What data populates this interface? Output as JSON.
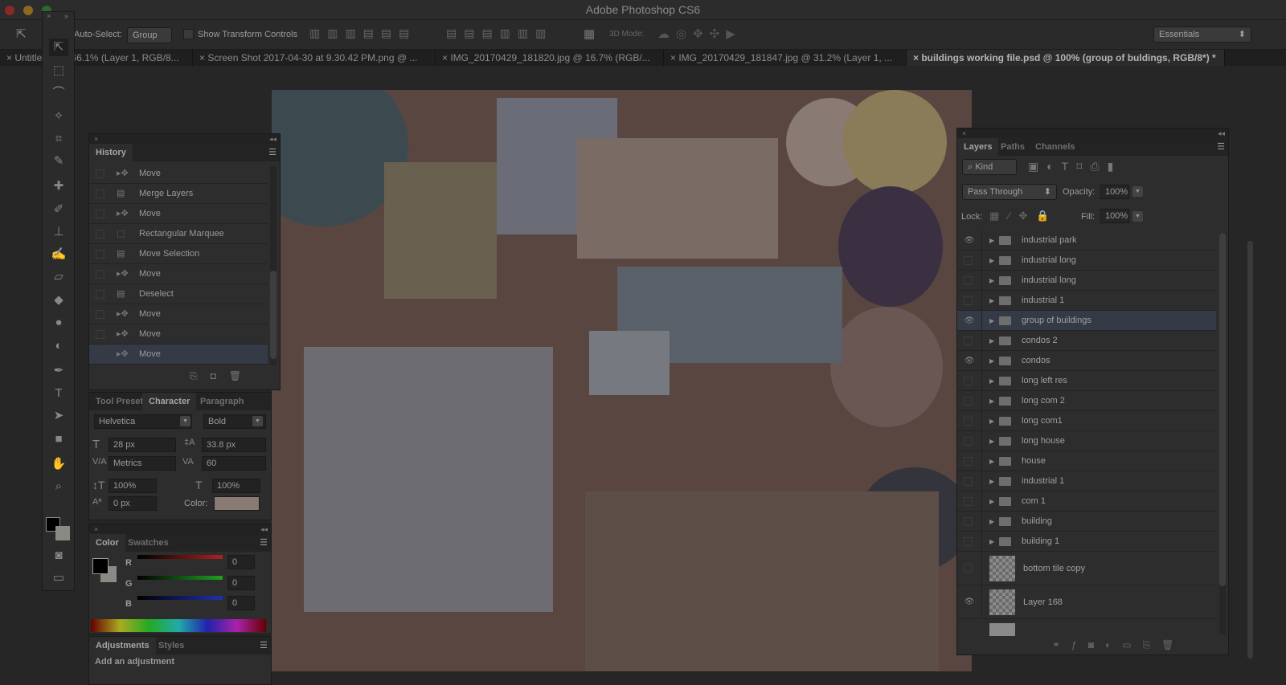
{
  "app": {
    "title": "Adobe Photoshop CS6"
  },
  "options": {
    "auto_select_label": "Auto-Select:",
    "auto_select_value": "Group",
    "show_transform": "Show Transform Controls",
    "mode_3d": "3D Mode:",
    "workspace": "Essentials"
  },
  "tabs": [
    {
      "label": "Untitled-1 @ 66.1% (Layer 1, RGB/8..."
    },
    {
      "label": "Screen Shot 2017-04-30 at 9.30.42 PM.png @ ..."
    },
    {
      "label": "IMG_20170429_181820.jpg @ 16.7% (RGB/..."
    },
    {
      "label": "IMG_20170429_181847.jpg @ 31.2% (Layer 1, ..."
    },
    {
      "label": "buildings working file.psd @ 100% (group of buldings, RGB/8*) *"
    }
  ],
  "history": {
    "title": "History",
    "items": [
      {
        "label": "Move",
        "icon": "move"
      },
      {
        "label": "Merge Layers",
        "icon": "doc"
      },
      {
        "label": "Move",
        "icon": "move"
      },
      {
        "label": "Rectangular Marquee",
        "icon": "marquee"
      },
      {
        "label": "Move Selection",
        "icon": "doc"
      },
      {
        "label": "Move",
        "icon": "move"
      },
      {
        "label": "Deselect",
        "icon": "doc"
      },
      {
        "label": "Move",
        "icon": "move"
      },
      {
        "label": "Move",
        "icon": "move"
      },
      {
        "label": "Move",
        "icon": "move"
      }
    ]
  },
  "character": {
    "tabs": [
      "Tool Preset",
      "Character",
      "Paragraph"
    ],
    "font": "Helvetica",
    "style": "Bold",
    "size": "28 px",
    "leading": "33.8 px",
    "kerning": "Metrics",
    "tracking": "60",
    "vscale": "100%",
    "hscale": "100%",
    "baseline": "0 px",
    "color_label": "Color:",
    "color": "#8a7a74"
  },
  "color": {
    "tabs": [
      "Color",
      "Swatches"
    ],
    "r_label": "R",
    "g_label": "G",
    "b_label": "B",
    "r": "0",
    "g": "0",
    "b": "0"
  },
  "adjustments": {
    "tabs": [
      "Adjustments",
      "Styles"
    ],
    "hint": "Add an adjustment"
  },
  "layers": {
    "tabs": [
      "Layers",
      "Paths",
      "Channels"
    ],
    "kind": "Kind",
    "blend": "Pass Through",
    "opacity_label": "Opacity:",
    "opacity": "100%",
    "lock_label": "Lock:",
    "fill_label": "Fill:",
    "fill": "100%",
    "items": [
      {
        "name": "industrial park",
        "visible": true,
        "type": "group"
      },
      {
        "name": "industrial long",
        "visible": false,
        "type": "group"
      },
      {
        "name": "industrial long",
        "visible": false,
        "type": "group"
      },
      {
        "name": "industrial 1",
        "visible": false,
        "type": "group"
      },
      {
        "name": "group of buildings",
        "visible": true,
        "type": "group",
        "selected": true
      },
      {
        "name": "condos 2",
        "visible": false,
        "type": "group"
      },
      {
        "name": "condos",
        "visible": true,
        "type": "group"
      },
      {
        "name": "long left res",
        "visible": false,
        "type": "group"
      },
      {
        "name": "long com 2",
        "visible": false,
        "type": "group"
      },
      {
        "name": "long com1",
        "visible": false,
        "type": "group"
      },
      {
        "name": "long house",
        "visible": false,
        "type": "group"
      },
      {
        "name": "house",
        "visible": false,
        "type": "group"
      },
      {
        "name": "industrial 1",
        "visible": false,
        "type": "group"
      },
      {
        "name": "com 1",
        "visible": false,
        "type": "group"
      },
      {
        "name": "building",
        "visible": false,
        "type": "group"
      },
      {
        "name": "building 1",
        "visible": false,
        "type": "group"
      },
      {
        "name": "bottom tile copy",
        "visible": false,
        "type": "pixel"
      },
      {
        "name": "Layer 168",
        "visible": true,
        "type": "pixel"
      }
    ]
  }
}
